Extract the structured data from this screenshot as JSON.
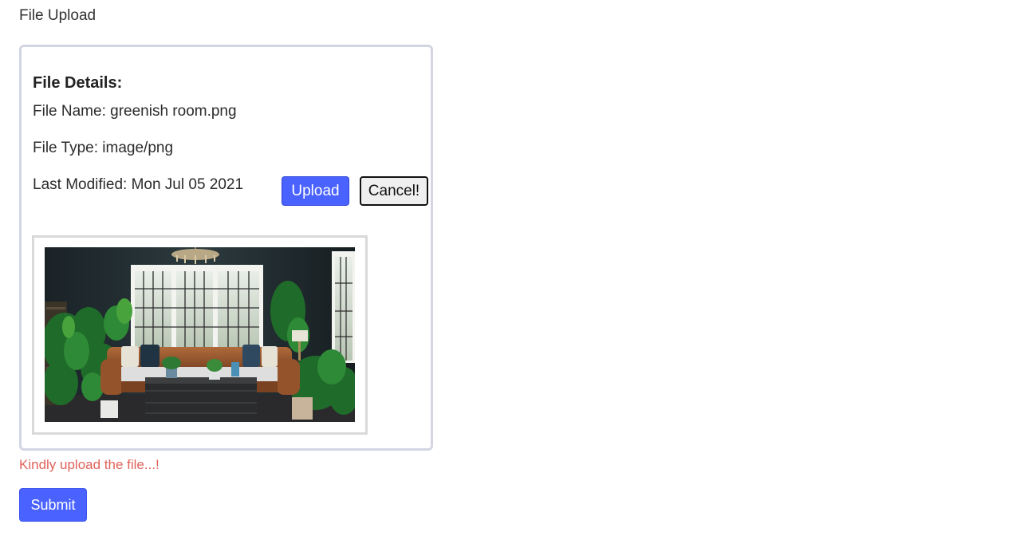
{
  "page": {
    "title": "File Upload"
  },
  "file_details": {
    "heading": "File Details:",
    "file_name": "File Name: greenish room.png",
    "file_type": "File Type: image/png",
    "last_modified": "Last Modified: Mon Jul 05 2021"
  },
  "actions": {
    "upload_label": "Upload",
    "cancel_label": "Cancel!"
  },
  "preview": {
    "subject": "greenish room interior with leather sofa, plants and tall windows"
  },
  "form": {
    "error_message": "Kindly upload the file...!",
    "submit_label": "Submit"
  },
  "colors": {
    "primary_button": "#4a62ff",
    "error_text": "#e0625a",
    "card_border": "#d3d5e3"
  }
}
